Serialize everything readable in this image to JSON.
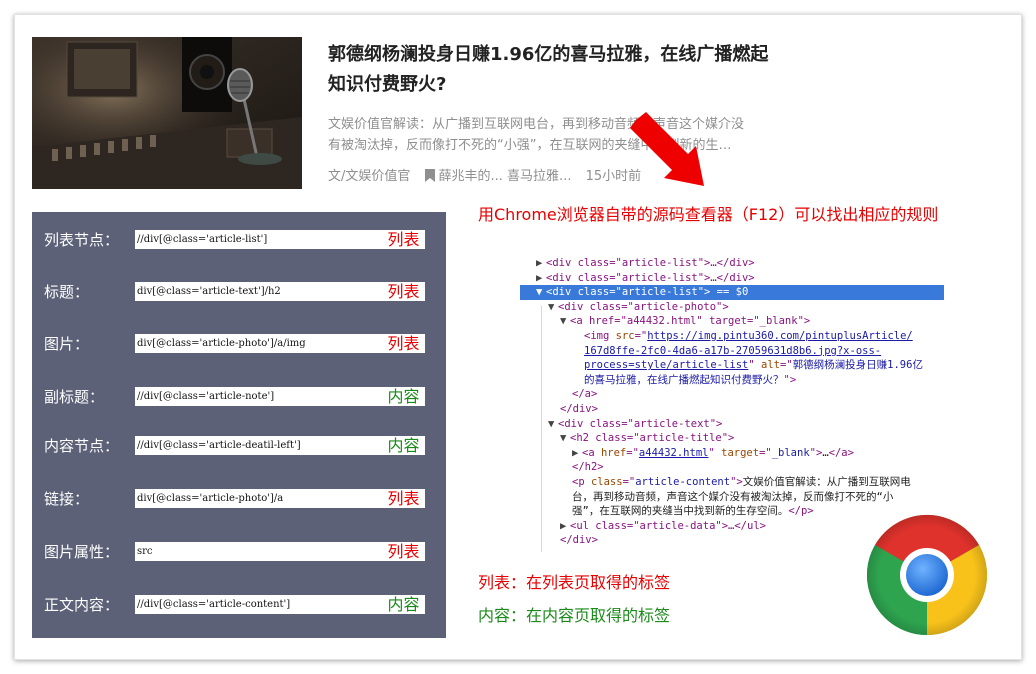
{
  "article": {
    "title_line1": "郭德纲杨澜投身日赚1.96亿的喜马拉雅，在线广播燃起",
    "title_line2": "知识付费野火?",
    "summary_line1": "文娱价值官解读：从广播到互联网电台，再到移动音频，声音这个媒介没",
    "summary_line2": "有被淘汰掉，反而像打不死的“小强”，在互联网的夹缝中找到新的生…",
    "author": "文/文娱价值官",
    "tag_icon": "bookmark-icon",
    "tags": "薛兆丰的...   喜马拉雅...",
    "time": "15小时前"
  },
  "rules": [
    {
      "label": "列表节点：",
      "xpath": "//div[@class='article-list']",
      "tag": "列表",
      "tag_color": "#e60000"
    },
    {
      "label": "标题：",
      "xpath": "div[@class='article-text']/h2",
      "tag": "列表",
      "tag_color": "#e60000"
    },
    {
      "label": "图片：",
      "xpath": "div[@class='article-photo']/a/img",
      "tag": "列表",
      "tag_color": "#e60000"
    },
    {
      "label": "副标题：",
      "xpath": "//div[@class='article-note']",
      "tag": "内容",
      "tag_color": "#1b8a1b"
    },
    {
      "label": "内容节点：",
      "xpath": "//div[@class='article-deatil-left']",
      "tag": "内容",
      "tag_color": "#1b8a1b"
    },
    {
      "label": "链接：",
      "xpath": "div[@class='article-photo']/a",
      "tag": "列表",
      "tag_color": "#e60000"
    },
    {
      "label": "图片属性：",
      "xpath": "src",
      "tag": "列表",
      "tag_color": "#e60000"
    },
    {
      "label": "正文内容：",
      "xpath": "//div[@class='article-content']",
      "tag": "内容",
      "tag_color": "#1b8a1b"
    }
  ],
  "headline": "用Chrome浏览器自带的源码查看器（F12）可以找出相应的规则",
  "devtools": {
    "article_list_1": "<div class=\"article-list\">…</div>",
    "article_list_2": "<div class=\"article-list\">…</div>",
    "selected": "<div class=\"article-list\"> == $0",
    "photo_open": "<div class=\"article-photo\">",
    "a_open_tag": "<a href=\"a44432.html\" target=\"_blank\">",
    "img_src_1": "https://img.pintu360.com/pintuplusArticle/",
    "img_src_2": "167d8ffe-2fc0-4da6-a17b-27059631d8b6.jpg?x-oss-",
    "img_src_3": "process=style/article-list",
    "img_alt_1": "郭德纲杨澜投身日赚1.96亿",
    "img_alt_2": "的喜马拉雅，在线广播燃起知识付费野火？",
    "a_close": "</a>",
    "div_close": "</div>",
    "text_open": "<div class=\"article-text\">",
    "h2_open": "<h2 class=\"article-title\">",
    "h2_link": "a44432.html",
    "h2_close": "</h2>",
    "content_text_1": "文娱价值官解读：从广播到互联网电",
    "content_text_2": "台，再到移动音频，声音这个媒介没有被淘汰掉，反而像打不死的“小",
    "content_text_3": "强”，在互联网的夹缝当中找到新的生存空间。",
    "ul_line": "<ul class=\"article-data\">…</ul>",
    "end_div": "</div>"
  },
  "legend": {
    "list": "列表：在列表页取得的标签",
    "content": "内容：在内容页取得的标签"
  },
  "colors": {
    "panel_bg": "#5c6178",
    "list_red": "#e60000",
    "content_green": "#1b8a1b",
    "selection_blue": "#3879d9"
  },
  "icons": {
    "arrow": "red-arrow-icon",
    "browser_logo": "chrome-logo-icon"
  }
}
